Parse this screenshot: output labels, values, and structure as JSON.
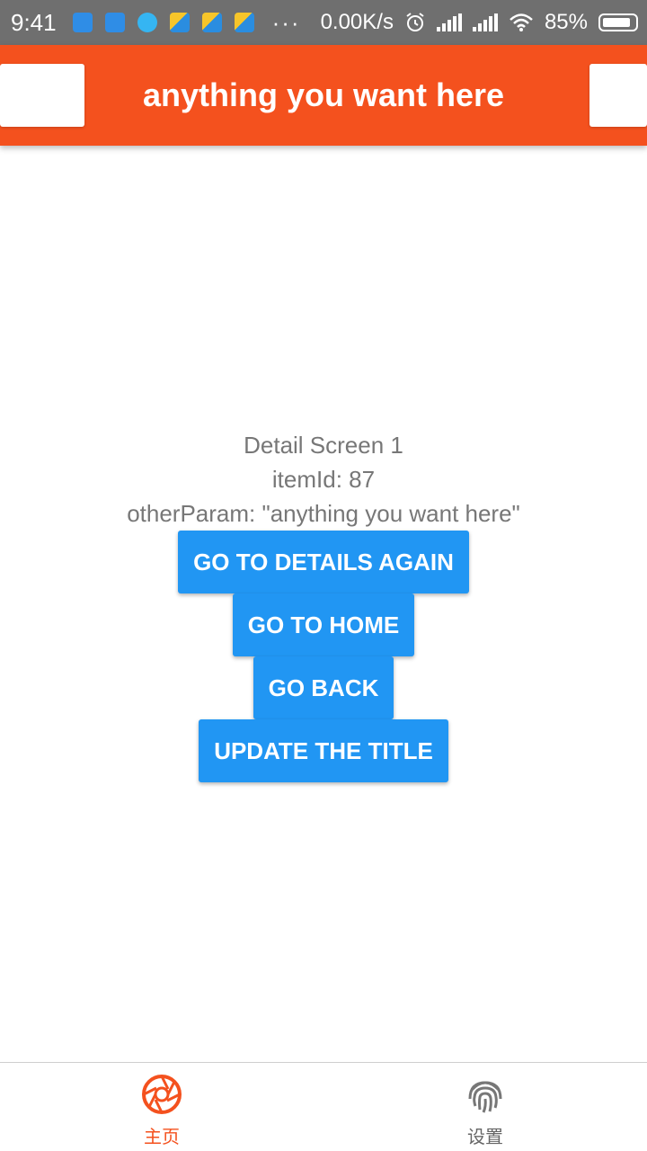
{
  "status_bar": {
    "time": "9:41",
    "dots": "···",
    "net_speed": "0.00K/s",
    "battery": "85%",
    "notification_icons": [
      "app-icon",
      "download-icon",
      "bird-icon",
      "image-icon",
      "image-icon",
      "image-icon"
    ]
  },
  "header": {
    "title": "anything you want here",
    "color": "#f4511e"
  },
  "detail": {
    "screen_label": "Detail Screen 1",
    "item_id": "itemId: 87",
    "other_param": "otherParam: \"anything you want here\""
  },
  "buttons": {
    "details_again": "GO TO DETAILS AGAIN",
    "home": "GO TO HOME",
    "back": "GO BACK",
    "update_title": "UPDATE THE TITLE",
    "color": "#2196f3"
  },
  "tabs": [
    {
      "label": "主页",
      "icon": "aperture-icon",
      "active": true
    },
    {
      "label": "设置",
      "icon": "fingerprint-icon",
      "active": false
    }
  ]
}
